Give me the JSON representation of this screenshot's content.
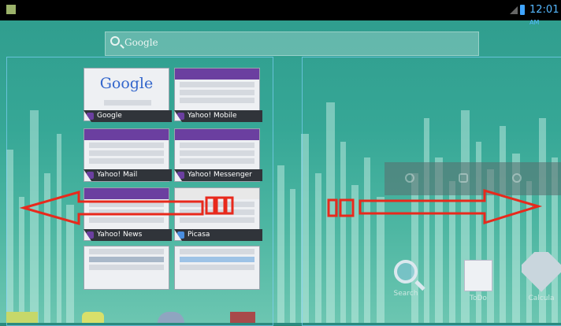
{
  "status_bar": {
    "time": "12:01",
    "ampm": "AM"
  },
  "search": {
    "label": "Google"
  },
  "thumbnails": [
    {
      "label": "Google",
      "logo": "Google"
    },
    {
      "label": "Yahoo! Mobile"
    },
    {
      "label": "Yahoo! Mail"
    },
    {
      "label": "Yahoo! Messenger"
    },
    {
      "label": "Yahoo! News"
    },
    {
      "label": "Picasa"
    }
  ],
  "apps": {
    "search": "Search",
    "todo": "ToDo",
    "calc": "Calcula"
  },
  "colors": {
    "arrow": "#e8291c",
    "accent": "#3fa4ff",
    "wallpaper": "#36a796"
  },
  "icons": [
    "search-icon",
    "signal-icon",
    "battery-icon",
    "wifi-icon",
    "bluetooth-icon",
    "gps-icon",
    "magnifier-icon",
    "todo-icon",
    "calculator-icon"
  ]
}
